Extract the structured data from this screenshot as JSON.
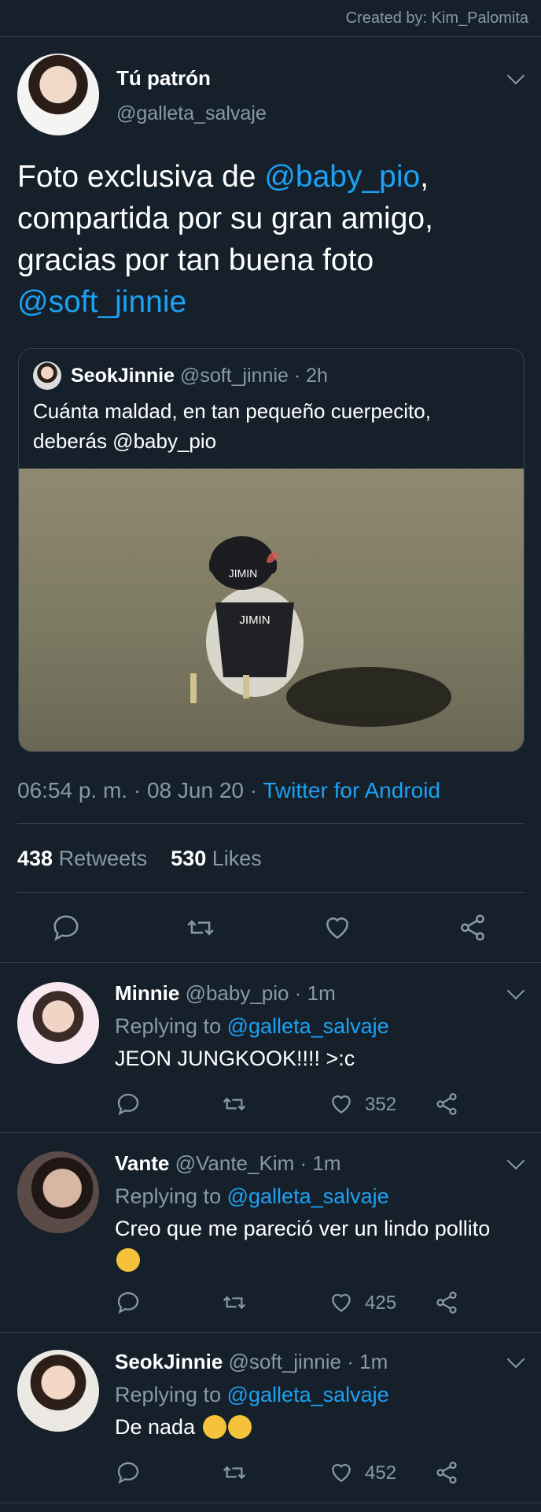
{
  "credit": "Created by: Kim_Palomita",
  "main_tweet": {
    "name": "Tú patrón",
    "handle": "@galleta_salvaje",
    "text_parts": {
      "p1": "Foto exclusiva de ",
      "mention1": "@baby_pio",
      "p2": ",",
      "p3": "compartida por su gran amigo,",
      "p4": "gracias por tan buena foto",
      "mention2": "@soft_jinnie"
    },
    "quote": {
      "name": "SeokJinnie",
      "handle": "@soft_jinnie",
      "time": "· 2h",
      "text": "Cuánta maldad, en tan pequeño cuerpecito, deberás @baby_pio",
      "image": {
        "hat_text": "JIMIN",
        "vest_text": "JIMIN"
      }
    },
    "time": "06:54 p. m.",
    "date": "· 08 Jun 20 ·",
    "source": "Twitter for Android",
    "retweets": "438",
    "retweets_label": "Retweets",
    "likes": "530",
    "likes_label": "Likes"
  },
  "replies": [
    {
      "name": "Minnie",
      "handle": "@baby_pio",
      "time": "· 1m",
      "replying_label": "Replying to",
      "replying_to": "@galleta_salvaje",
      "text": "JEON JUNGKOOK!!!! >:c",
      "likes": "352"
    },
    {
      "name": "Vante",
      "handle": "@Vante_Kim",
      "time": "· 1m",
      "replying_label": "Replying to",
      "replying_to": "@galleta_salvaje",
      "text": "Creo que me pareció ver un lindo pollito",
      "likes": "425"
    },
    {
      "name": "SeokJinnie",
      "handle": "@soft_jinnie",
      "time": "· 1m",
      "replying_label": "Replying to",
      "replying_to": "@galleta_salvaje",
      "text": "De nada",
      "likes": "452"
    }
  ],
  "icons": {
    "reply": "speech-bubble-icon",
    "retweet": "retweet-icon",
    "like": "heart-icon",
    "share": "share-icon",
    "menu": "chevron-down-icon"
  },
  "colors": {
    "background": "#15202b",
    "accent": "#1da1f2",
    "muted": "#8899a6",
    "divider": "#38444d"
  }
}
